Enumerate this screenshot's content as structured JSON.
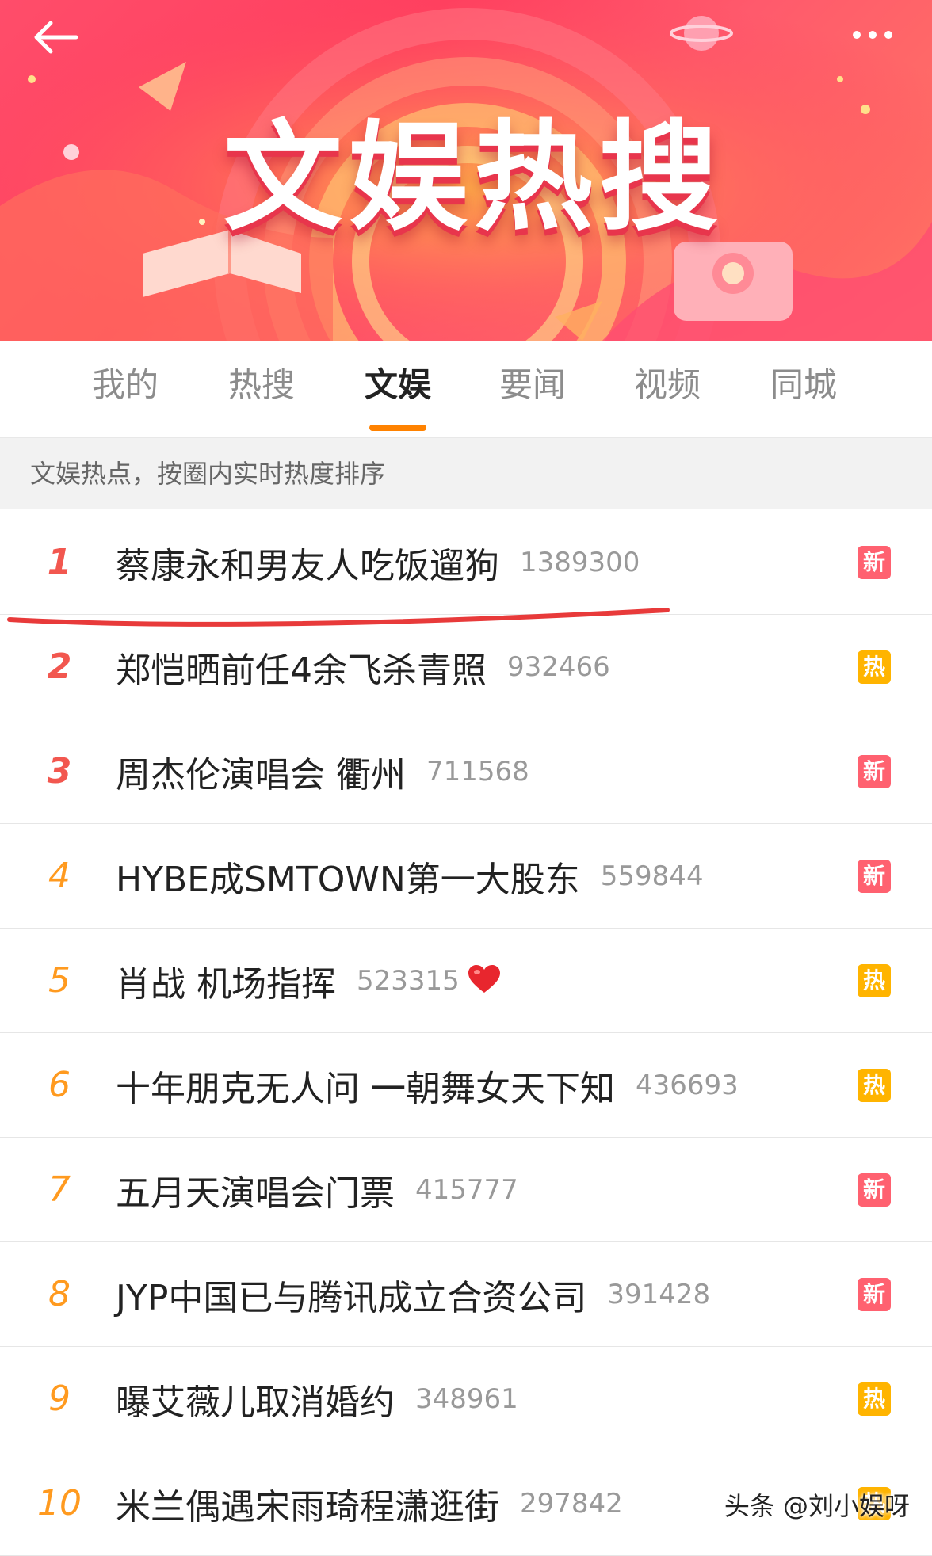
{
  "banner": {
    "title": "文娱热搜",
    "back_icon": "arrow-left-icon",
    "more_icon": "more-dots-icon"
  },
  "tabs": [
    {
      "label": "我的",
      "active": false
    },
    {
      "label": "热搜",
      "active": false
    },
    {
      "label": "文娱",
      "active": true
    },
    {
      "label": "要闻",
      "active": false
    },
    {
      "label": "视频",
      "active": false
    },
    {
      "label": "同城",
      "active": false
    }
  ],
  "subheader": "文娱热点，按圈内实时热度排序",
  "list": [
    {
      "rank": "1",
      "topic": "蔡康永和男友人吃饭遛狗",
      "count": "1389300",
      "badge": "新",
      "badge_type": "new"
    },
    {
      "rank": "2",
      "topic": "郑恺晒前任4余飞杀青照",
      "count": "932466",
      "badge": "热",
      "badge_type": "hot"
    },
    {
      "rank": "3",
      "topic": "周杰伦演唱会 衢州",
      "count": "711568",
      "badge": "新",
      "badge_type": "new"
    },
    {
      "rank": "4",
      "topic": "HYBE成SMTOWN第一大股东",
      "count": "559844",
      "badge": "新",
      "badge_type": "new"
    },
    {
      "rank": "5",
      "topic": "肖战 机场指挥",
      "count": "523315",
      "badge": "热",
      "badge_type": "hot",
      "icon": "heart-icon"
    },
    {
      "rank": "6",
      "topic": "十年朋克无人问 一朝舞女天下知",
      "count": "436693",
      "badge": "热",
      "badge_type": "hot"
    },
    {
      "rank": "7",
      "topic": "五月天演唱会门票",
      "count": "415777",
      "badge": "新",
      "badge_type": "new"
    },
    {
      "rank": "8",
      "topic": "JYP中国已与腾讯成立合资公司",
      "count": "391428",
      "badge": "新",
      "badge_type": "new"
    },
    {
      "rank": "9",
      "topic": "曝艾薇儿取消婚约",
      "count": "348961",
      "badge": "热",
      "badge_type": "hot"
    },
    {
      "rank": "10",
      "topic": "米兰偶遇宋雨琦程潇逛街",
      "count": "297842",
      "badge": "热",
      "badge_type": "hot"
    }
  ],
  "watermark": "头条 @刘小娱呀",
  "colors": {
    "banner": "#ff4d6a",
    "tab_indicator": "#ff8200",
    "rank_top": "#f2574f",
    "rank_mid": "#ff9a1f",
    "badge_new": "#ff6170",
    "badge_hot": "#ffb400",
    "annotation_underline": "#e83a3a"
  }
}
